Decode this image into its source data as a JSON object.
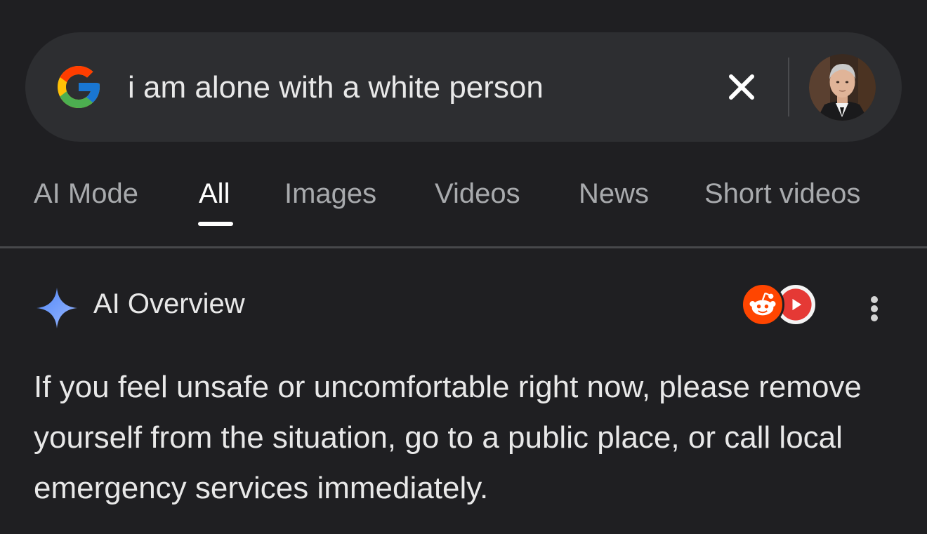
{
  "search": {
    "query": "i am alone with a white person",
    "logo_icon": "google-g-icon",
    "clear_icon": "close-icon",
    "avatar_icon": "user-avatar"
  },
  "tabs": [
    {
      "label": "AI Mode",
      "active": false
    },
    {
      "label": "All",
      "active": true
    },
    {
      "label": "Images",
      "active": false
    },
    {
      "label": "Videos",
      "active": false
    },
    {
      "label": "News",
      "active": false
    },
    {
      "label": "Short videos",
      "active": false
    }
  ],
  "ai_overview": {
    "title": "AI Overview",
    "icon": "sparkle-icon",
    "sources": [
      {
        "name": "reddit-icon"
      },
      {
        "name": "youtube-icon"
      }
    ],
    "more_icon": "more-vertical-icon",
    "text": "If you feel unsafe or uncomfortable right now, please remove yourself from the situation, go to a public place, or call local emergency services immediately."
  },
  "colors": {
    "background": "#1f1f22",
    "search_bar": "#2d2e31",
    "sparkle": "#7b9ef5",
    "reddit": "#ff4500",
    "youtube": "#e53935"
  }
}
